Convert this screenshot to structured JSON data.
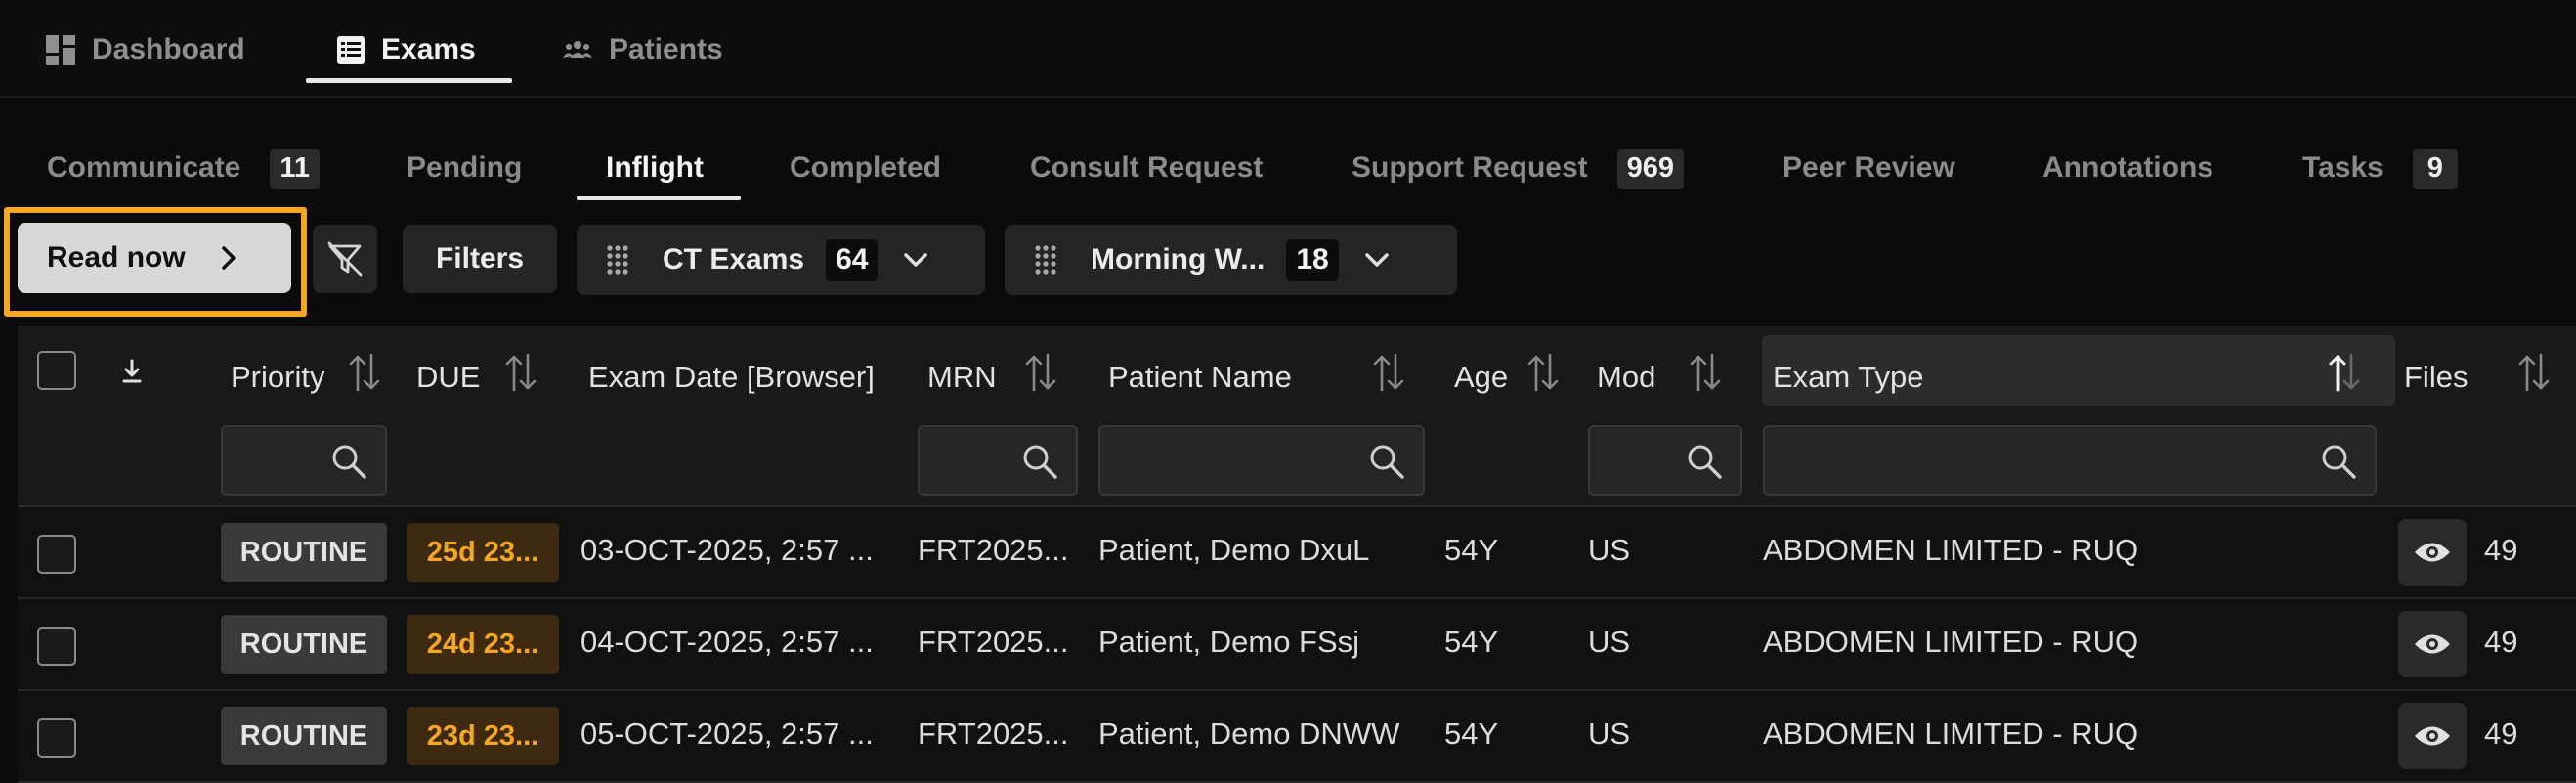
{
  "nav": {
    "items": [
      {
        "label": "Dashboard",
        "icon": "dashboard-icon"
      },
      {
        "label": "Exams",
        "icon": "list-icon"
      },
      {
        "label": "Patients",
        "icon": "users-icon"
      }
    ],
    "active": "Exams"
  },
  "subtabs": [
    {
      "label": "Communicate",
      "count": "11"
    },
    {
      "label": "Pending",
      "count": ""
    },
    {
      "label": "Inflight",
      "count": ""
    },
    {
      "label": "Completed",
      "count": ""
    },
    {
      "label": "Consult Request",
      "count": ""
    },
    {
      "label": "Support Request",
      "count": "969"
    },
    {
      "label": "Peer Review",
      "count": ""
    },
    {
      "label": "Annotations",
      "count": ""
    },
    {
      "label": "Tasks",
      "count": "9"
    }
  ],
  "active_subtab": "Inflight",
  "toolbar": {
    "read_now_label": "Read now",
    "filters_label": "Filters",
    "worklists": [
      {
        "label": "CT Exams",
        "count": "64"
      },
      {
        "label": "Morning W...",
        "count": "18"
      }
    ]
  },
  "colors": {
    "accent_focus": "#f5a623",
    "due_text": "#f5a623",
    "due_bg": "#3d2a10"
  },
  "table": {
    "columns": {
      "priority": "Priority",
      "due": "DUE",
      "exam_date": "Exam Date [Browser]",
      "mrn": "MRN",
      "patient_name": "Patient Name",
      "age": "Age",
      "mod": "Mod",
      "exam_type": "Exam Type",
      "files": "Files"
    },
    "rows": [
      {
        "priority": "ROUTINE",
        "due": "25d 23...",
        "exam_date": "03-OCT-2025, 2:57 ...",
        "mrn": "FRT2025...",
        "patient_name": "Patient, Demo DxuL",
        "age": "54Y",
        "mod": "US",
        "exam_type": "ABDOMEN LIMITED - RUQ",
        "files": "49"
      },
      {
        "priority": "ROUTINE",
        "due": "24d 23...",
        "exam_date": "04-OCT-2025, 2:57 ...",
        "mrn": "FRT2025...",
        "patient_name": "Patient, Demo FSsj",
        "age": "54Y",
        "mod": "US",
        "exam_type": "ABDOMEN LIMITED - RUQ",
        "files": "49"
      },
      {
        "priority": "ROUTINE",
        "due": "23d 23...",
        "exam_date": "05-OCT-2025, 2:57 ...",
        "mrn": "FRT2025...",
        "patient_name": "Patient, Demo DNWW",
        "age": "54Y",
        "mod": "US",
        "exam_type": "ABDOMEN LIMITED - RUQ",
        "files": "49"
      }
    ]
  }
}
